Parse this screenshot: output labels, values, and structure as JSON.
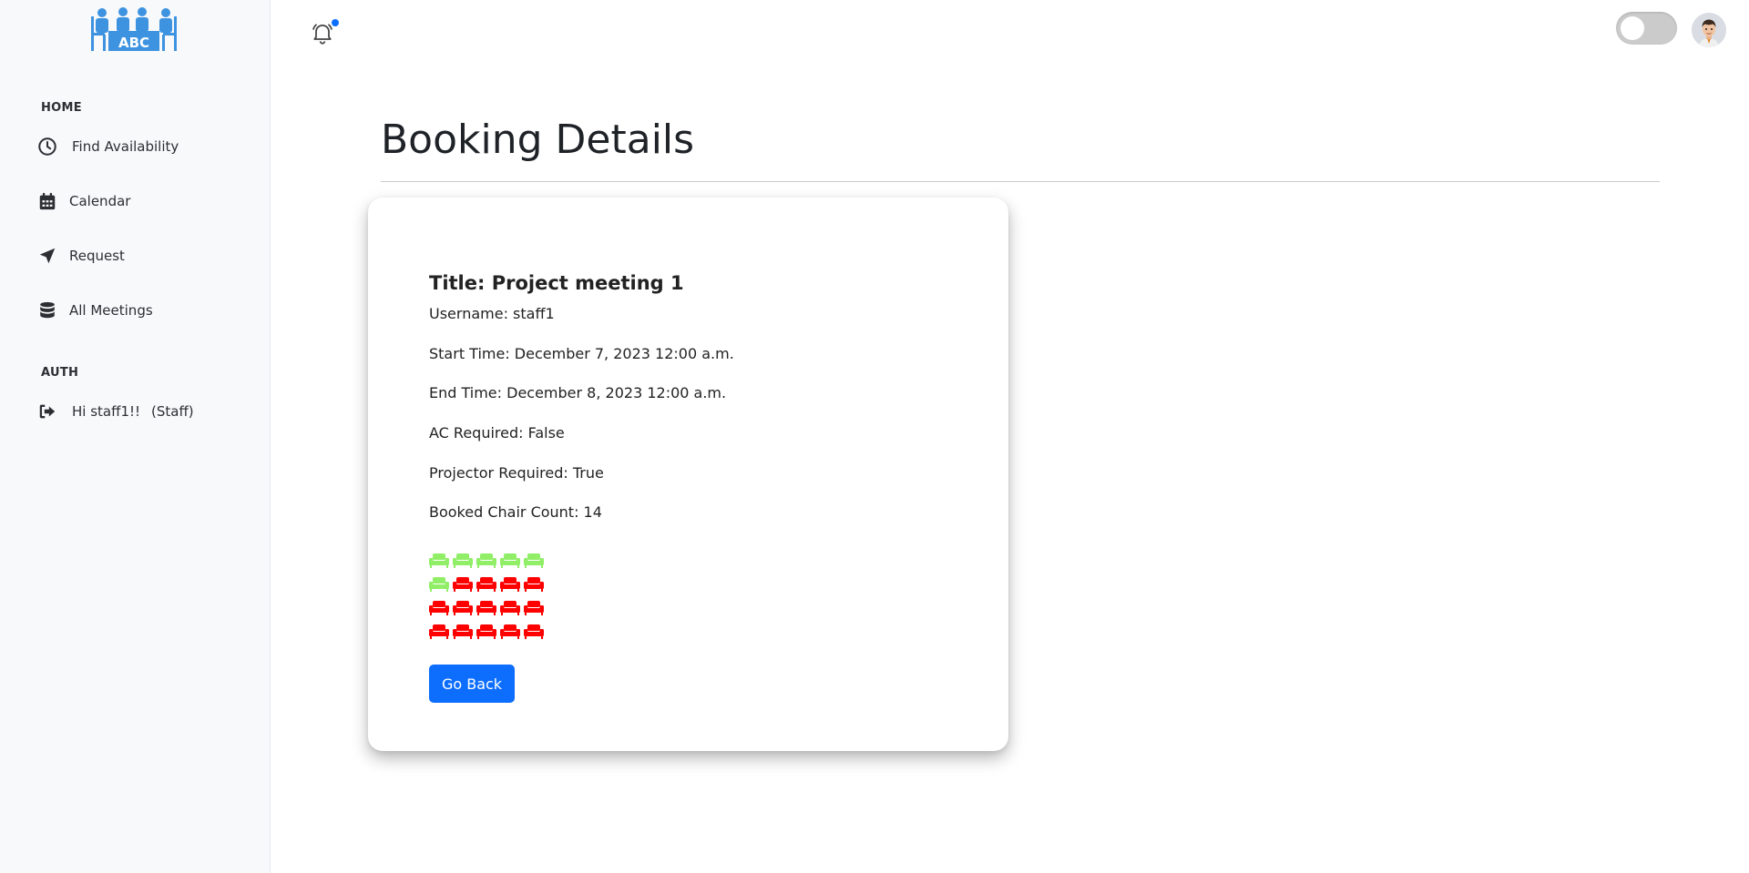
{
  "logo": {
    "text": "ABC",
    "color": "#3d93e0"
  },
  "sidebar": {
    "sections": [
      {
        "heading": "HOME"
      },
      {
        "heading": "AUTH"
      }
    ],
    "items": [
      {
        "label": "Find Availability",
        "icon": "clock-icon"
      },
      {
        "label": "Calendar",
        "icon": "calendar-icon"
      },
      {
        "label": "Request",
        "icon": "send-arrow-icon"
      },
      {
        "label": "All Meetings",
        "icon": "database-icon"
      }
    ],
    "auth_item": {
      "label": "Hi staff1!!",
      "role": "(Staff)",
      "icon": "logout-icon"
    }
  },
  "topbar": {
    "notification_icon": "bell-icon",
    "notification_dot_color": "#0d6efd",
    "theme_toggle": "off",
    "avatar_icon": "avatar-icon"
  },
  "page": {
    "title": "Booking Details"
  },
  "booking": {
    "title": "Title: Project meeting 1",
    "username": "Username: staff1",
    "start_time": "Start Time: December 7, 2023 12:00 a.m.",
    "end_time": "End Time: December 8, 2023 12:00 a.m.",
    "ac_required": "AC Required: False",
    "projector_required": "Projector Required: True",
    "booked_chair_count": "Booked Chair Count: 14",
    "seat_grid": {
      "colors": {
        "available": "#90ee67",
        "booked": "#ff0000"
      },
      "rows": [
        [
          "available",
          "available",
          "available",
          "available",
          "available"
        ],
        [
          "available",
          "booked",
          "booked",
          "booked",
          "booked"
        ],
        [
          "booked",
          "booked",
          "booked",
          "booked",
          "booked"
        ],
        [
          "booked",
          "booked",
          "booked",
          "booked",
          "booked"
        ]
      ]
    },
    "go_back_label": "Go Back"
  }
}
